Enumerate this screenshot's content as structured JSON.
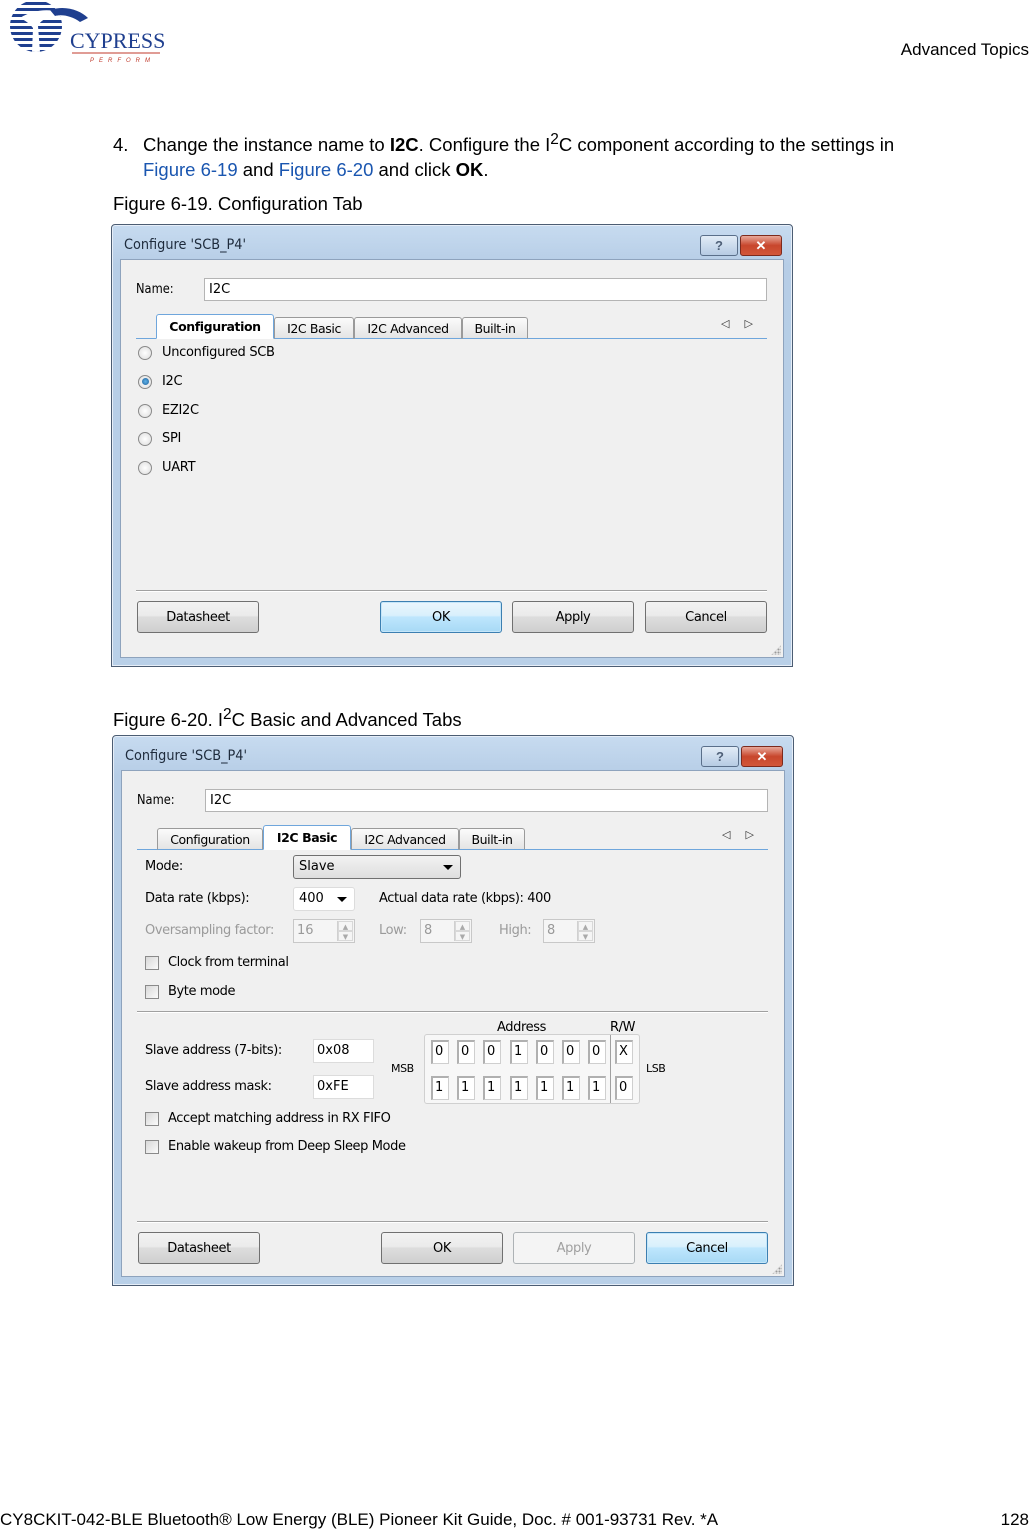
{
  "header": {
    "logo_text": "CYPRESS",
    "logo_tagline": "PERFORM",
    "section_title": "Advanced Topics"
  },
  "instruction": {
    "number": "4.",
    "text_1": "Change the instance name to ",
    "bold_1": "I2C",
    "text_2": ". Configure the I",
    "sup": "2",
    "text_3": "C component according to the settings in",
    "link_1": "Figure 6-19",
    "text_4": " and ",
    "link_2": "Figure 6-20",
    "text_5": " and click ",
    "bold_2": "OK",
    "text_6": "."
  },
  "figure_1": {
    "caption": "Figure 6-19.  Configuration Tab",
    "dialog": {
      "title": "Configure 'SCB_P4'",
      "help_glyph": "?",
      "close_glyph": "✕",
      "name_label": "Name:",
      "name_value": "I2C",
      "tabs": [
        {
          "label": "Configuration",
          "active": true
        },
        {
          "label": "I2C Basic",
          "active": false
        },
        {
          "label": "I2C Advanced",
          "active": false
        },
        {
          "label": "Built-in",
          "active": false
        }
      ],
      "tab_scroll": "◁ ▷",
      "radios": [
        {
          "label": "Unconfigured SCB",
          "selected": false
        },
        {
          "label": "I2C",
          "selected": true
        },
        {
          "label": "EZI2C",
          "selected": false
        },
        {
          "label": "SPI",
          "selected": false
        },
        {
          "label": "UART",
          "selected": false
        }
      ],
      "buttons": {
        "datasheet": "Datasheet",
        "ok": "OK",
        "apply": "Apply",
        "cancel": "Cancel"
      }
    }
  },
  "figure_2": {
    "caption_pre": "Figure 6-20.  I",
    "caption_sup": "2",
    "caption_post": "C Basic and Advanced Tabs",
    "dialog": {
      "title": "Configure 'SCB_P4'",
      "help_glyph": "?",
      "close_glyph": "✕",
      "name_label": "Name:",
      "name_value": "I2C",
      "tabs": [
        {
          "label": "Configuration",
          "active": false
        },
        {
          "label": "I2C Basic",
          "active": true
        },
        {
          "label": "I2C Advanced",
          "active": false
        },
        {
          "label": "Built-in",
          "active": false
        }
      ],
      "tab_scroll": "◁ ▷",
      "mode_label": "Mode:",
      "mode_value": "Slave",
      "data_rate_label": "Data rate (kbps):",
      "data_rate_value": "400",
      "actual_rate_text": "Actual data rate (kbps): 400",
      "oversampling_label": "Oversampling factor:",
      "oversampling_value": "16",
      "low_label": "Low:",
      "low_value": "8",
      "high_label": "High:",
      "high_value": "8",
      "checkboxes_top": [
        {
          "label": "Clock from terminal",
          "checked": false
        },
        {
          "label": "Byte mode",
          "checked": false
        }
      ],
      "address_header": "Address",
      "rw_header": "R/W",
      "slave_address_label": "Slave address (7-bits):",
      "slave_address_value": "0x08",
      "slave_mask_label": "Slave address mask:",
      "slave_mask_value": "0xFE",
      "msb_label": "MSB",
      "lsb_label": "LSB",
      "address_bits": [
        "0",
        "0",
        "0",
        "1",
        "0",
        "0",
        "0"
      ],
      "address_rw": "X",
      "mask_bits": [
        "1",
        "1",
        "1",
        "1",
        "1",
        "1",
        "1"
      ],
      "mask_rw": "0",
      "checkboxes_bottom": [
        {
          "label": "Accept matching address in RX FIFO",
          "checked": false
        },
        {
          "label": "Enable wakeup from Deep Sleep Mode",
          "checked": false
        }
      ],
      "buttons": {
        "datasheet": "Datasheet",
        "ok": "OK",
        "apply": "Apply",
        "cancel": "Cancel"
      }
    }
  },
  "footer": {
    "doc_title": "CY8CKIT-042-BLE Bluetooth® Low Energy (BLE) Pioneer Kit Guide, Doc. # 001-93731 Rev. *A",
    "page_number": "128"
  }
}
